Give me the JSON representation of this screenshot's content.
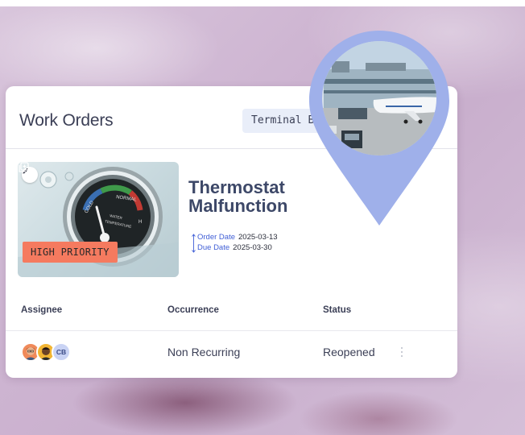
{
  "card": {
    "title": "Work Orders",
    "location": "Terminal B, gate 78"
  },
  "work_order": {
    "title": "Thermostat Malfunction",
    "priority": "HIGH PRIORITY",
    "order_date_label": "Order Date",
    "order_date": "2025-03-13",
    "due_date_label": "Due Date",
    "due_date": "2025-03-30",
    "gauge": {
      "top_label": "NORMAL",
      "left_label": "COLD",
      "right_label": "H",
      "center_label_1": "WATER",
      "center_label_2": "TEMPERATURE"
    }
  },
  "table": {
    "columns": [
      "Assignee",
      "Occurrence",
      "Status"
    ],
    "row": {
      "assignee_initials": "CB",
      "occurrence": "Non Recurring",
      "status": "Reopened"
    }
  },
  "icons": {
    "edit": "pencil-icon",
    "copy": "copy-add-icon",
    "menu": "more-vertical-icon",
    "dates": "up-down-arrow-icon"
  },
  "colors": {
    "accent_blue": "#3f5ed6",
    "priority": "#f57a5f",
    "pin": "#9fb0ea",
    "title": "#3d4868"
  }
}
